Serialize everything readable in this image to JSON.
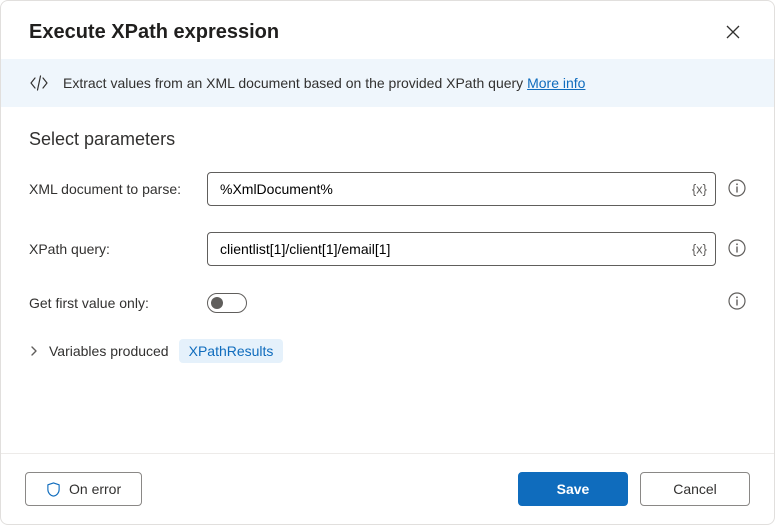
{
  "header": {
    "title": "Execute XPath expression"
  },
  "banner": {
    "description": "Extract values from an XML document based on the provided XPath query",
    "link_label": "More info"
  },
  "section": {
    "title": "Select parameters"
  },
  "fields": {
    "xml_document": {
      "label": "XML document to parse:",
      "value": "%XmlDocument%",
      "var_token": "{x}"
    },
    "xpath_query": {
      "label": "XPath query:",
      "value": "clientlist[1]/client[1]/email[1]",
      "var_token": "{x}"
    },
    "first_value_only": {
      "label": "Get first value only:",
      "value": false
    }
  },
  "variables": {
    "label": "Variables produced",
    "chip": "XPathResults"
  },
  "footer": {
    "on_error": "On error",
    "save": "Save",
    "cancel": "Cancel"
  }
}
